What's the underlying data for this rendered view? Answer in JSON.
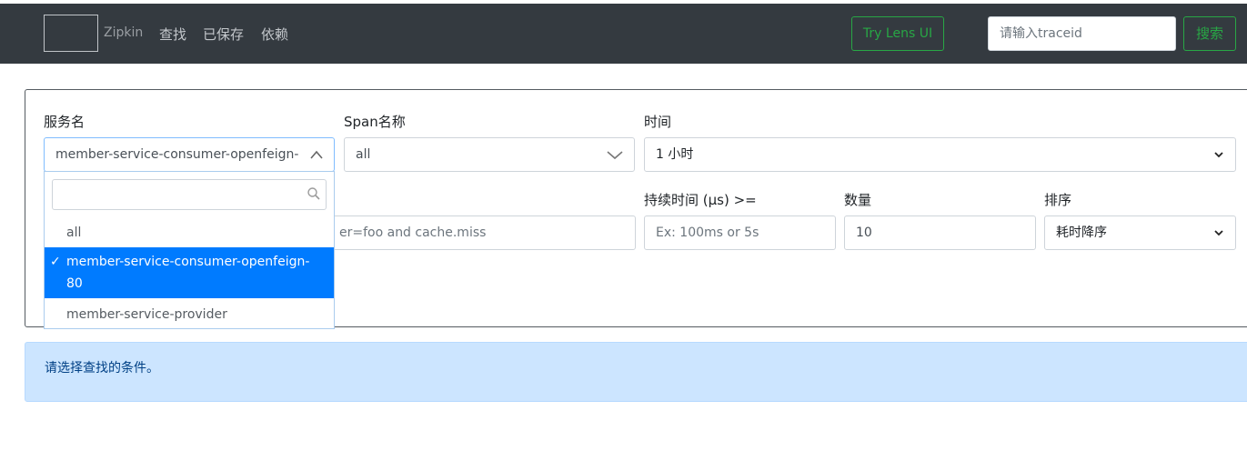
{
  "nav": {
    "brand": "Zipkin",
    "links": [
      "查找",
      "已保存",
      "依赖"
    ],
    "lens_button": "Try Lens UI",
    "traceid_placeholder": "请输入traceid",
    "search_button": "搜索"
  },
  "form": {
    "service": {
      "label": "服务名",
      "value": "member-service-consumer-openfeign-"
    },
    "span": {
      "label": "Span名称",
      "value": "all"
    },
    "time": {
      "label": "时间",
      "value": "1 小时"
    },
    "tags": {
      "placeholder_visible": "er=foo and cache.miss"
    },
    "duration": {
      "label": "持续时间 (μs) >=",
      "placeholder": "Ex: 100ms or 5s"
    },
    "limit": {
      "label": "数量",
      "value": "10"
    },
    "sort": {
      "label": "排序",
      "value": "耗时降序"
    }
  },
  "dropdown": {
    "options": [
      {
        "label": "all",
        "selected": false
      },
      {
        "label_line1": "member-service-consumer-openfeign-",
        "label_line2": "80",
        "selected": true
      },
      {
        "label": "member-service-provider",
        "selected": false
      }
    ]
  },
  "alert": {
    "text": "请选择查找的条件。"
  },
  "colors": {
    "navbar": "#343a40",
    "accent_green": "#28a745",
    "selected_blue": "#007bff",
    "alert_bg": "#cce5ff"
  }
}
